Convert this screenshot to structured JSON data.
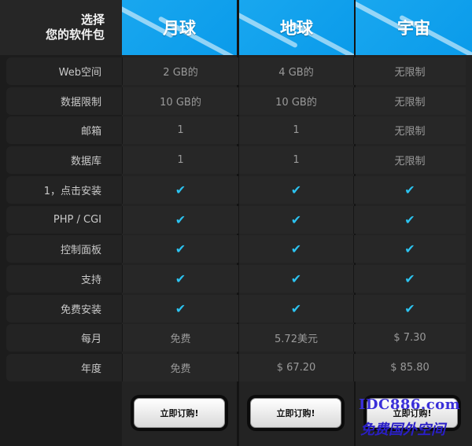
{
  "corner": {
    "line1": "选择",
    "line2": "您的软件包"
  },
  "plans": [
    {
      "name": "月球",
      "buy_label": "立即订购!"
    },
    {
      "name": "地球",
      "buy_label": "立即订购!"
    },
    {
      "name": "宇宙",
      "buy_label": "立即订购!"
    }
  ],
  "rows": [
    {
      "label": "Web空间",
      "values": [
        "2 GB的",
        "4 GB的",
        "无限制"
      ]
    },
    {
      "label": "数据限制",
      "values": [
        "10 GB的",
        "10 GB的",
        "无限制"
      ]
    },
    {
      "label": "邮箱",
      "values": [
        "1",
        "1",
        "无限制"
      ]
    },
    {
      "label": "数据库",
      "values": [
        "1",
        "1",
        "无限制"
      ]
    },
    {
      "label": "1，点击安装",
      "values": [
        "✔",
        "✔",
        "✔"
      ]
    },
    {
      "label": "PHP / CGI",
      "values": [
        "✔",
        "✔",
        "✔"
      ]
    },
    {
      "label": "控制面板",
      "values": [
        "✔",
        "✔",
        "✔"
      ]
    },
    {
      "label": "支持",
      "values": [
        "✔",
        "✔",
        "✔"
      ]
    },
    {
      "label": "免费安装",
      "values": [
        "✔",
        "✔",
        "✔"
      ]
    },
    {
      "label": "每月",
      "values": [
        "免费",
        "5.72美元",
        "$ 7.30"
      ]
    },
    {
      "label": "年度",
      "values": [
        "免费",
        "$ 67.20",
        "$ 85.80"
      ]
    }
  ],
  "watermark": {
    "line1": "IDC886.com",
    "line2": "免费国外空间"
  },
  "colors": {
    "header_blue": "#19a7ef",
    "check": "#2cc3f0"
  }
}
